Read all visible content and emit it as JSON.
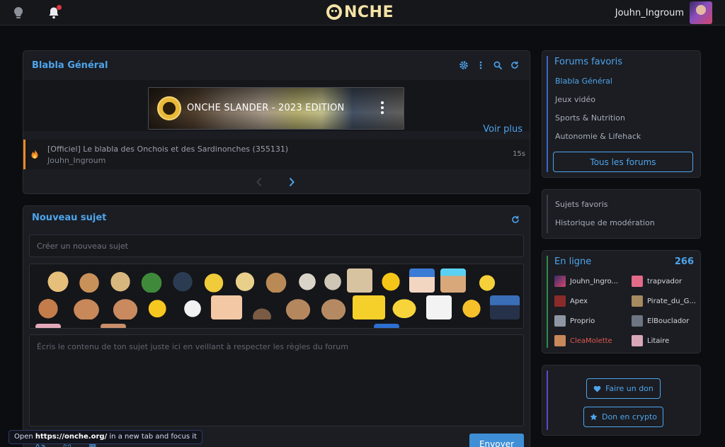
{
  "header": {
    "logo_text": "NCHE",
    "username": "Jouhn_Ingroum"
  },
  "blabla": {
    "title": "Blabla Général",
    "video_title": "ONCHE SLANDER - 2023 EDITION",
    "voir_plus": "Voir plus",
    "topic": {
      "title": "[Officiel] Le blabla des Onchois et des Sardinonches (355131)",
      "author": "Jouhn_Ingroum",
      "time": "15s"
    }
  },
  "nouveau": {
    "title": "Nouveau sujet",
    "subject_placeholder": "Créer un nouveau sujet",
    "body_placeholder": "Écris le contenu de ton sujet juste ici en veillant à respecter les règles du forum",
    "send_label": "Envoyer"
  },
  "tooltip": {
    "prefix": "Open ",
    "url": "https://onche.org/",
    "suffix": " in a new tab and focus it"
  },
  "favorites": {
    "title": "Forums favoris",
    "items": [
      {
        "label": "Blabla Général"
      },
      {
        "label": "Jeux vidéo"
      },
      {
        "label": "Sports & Nutrition"
      },
      {
        "label": "Autonomie & Lifehack"
      }
    ],
    "all_label": "Tous les forums"
  },
  "misc": {
    "items": [
      {
        "label": "Sujets favoris"
      },
      {
        "label": "Historique de modération"
      }
    ]
  },
  "online": {
    "title": "En ligne",
    "count": "266",
    "users": [
      {
        "name": "Jouhn_Ingro..."
      },
      {
        "name": "trapvador"
      },
      {
        "name": "Apex"
      },
      {
        "name": "Pirate_du_G..."
      },
      {
        "name": "Proprio"
      },
      {
        "name": "ElBouclador"
      },
      {
        "name": "CleaMolette"
      },
      {
        "name": "Litaire"
      }
    ]
  },
  "donate": {
    "don_label": "Faire un don",
    "crypto_label": "Don en crypto"
  }
}
